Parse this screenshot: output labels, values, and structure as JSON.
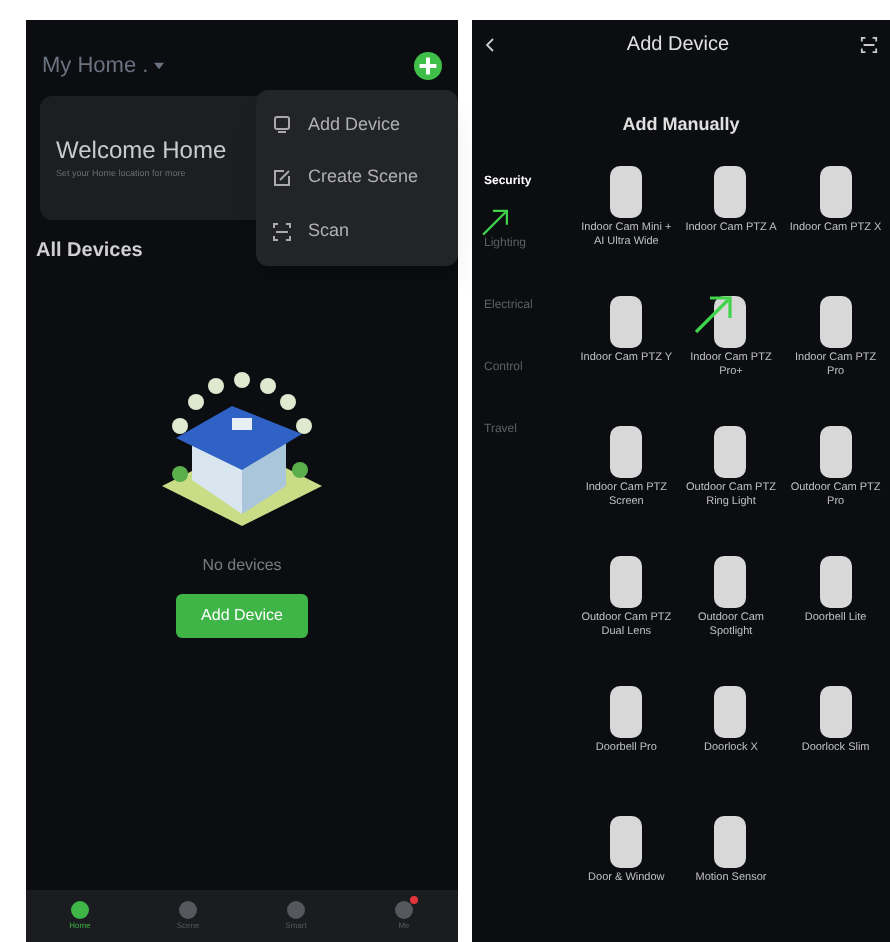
{
  "home_screen": {
    "home_name": "My Home .",
    "welcome": {
      "title": "Welcome Home",
      "subtitle": "Set your Home location for more"
    },
    "menu": [
      {
        "label": "Add Device",
        "kind": "device"
      },
      {
        "label": "Create Scene",
        "kind": "scene"
      },
      {
        "label": "Scan",
        "kind": "scan"
      }
    ],
    "section_title": "All Devices",
    "empty_text": "No devices",
    "add_button": "Add Device",
    "tabs": [
      {
        "label": "Home",
        "selected": true,
        "badge": false
      },
      {
        "label": "Scene",
        "selected": false,
        "badge": false
      },
      {
        "label": "Smart",
        "selected": false,
        "badge": false
      },
      {
        "label": "Me",
        "selected": false,
        "badge": true
      }
    ]
  },
  "add_device_screen": {
    "title": "Add Device",
    "subtitle": "Add Manually",
    "categories": [
      {
        "label": "Security",
        "selected": true
      },
      {
        "label": "Lighting",
        "selected": false
      },
      {
        "label": "Electrical",
        "selected": false
      },
      {
        "label": "Control",
        "selected": false
      },
      {
        "label": "Travel",
        "selected": false
      }
    ],
    "devices": [
      {
        "name": "Indoor Cam Mini + AI Ultra Wide"
      },
      {
        "name": "Indoor Cam PTZ A"
      },
      {
        "name": "Indoor Cam PTZ X"
      },
      {
        "name": "Indoor Cam PTZ Y"
      },
      {
        "name": "Indoor Cam PTZ Pro+"
      },
      {
        "name": "Indoor Cam PTZ Pro"
      },
      {
        "name": "Indoor Cam PTZ Screen"
      },
      {
        "name": "Outdoor Cam PTZ Ring Light"
      },
      {
        "name": "Outdoor Cam PTZ Pro"
      },
      {
        "name": "Outdoor Cam PTZ Dual Lens"
      },
      {
        "name": "Outdoor Cam Spotlight"
      },
      {
        "name": "Doorbell Lite"
      },
      {
        "name": "Doorbell Pro"
      },
      {
        "name": "Doorlock X"
      },
      {
        "name": "Doorlock Slim"
      },
      {
        "name": "Door & Window"
      },
      {
        "name": "Motion Sensor"
      }
    ]
  }
}
